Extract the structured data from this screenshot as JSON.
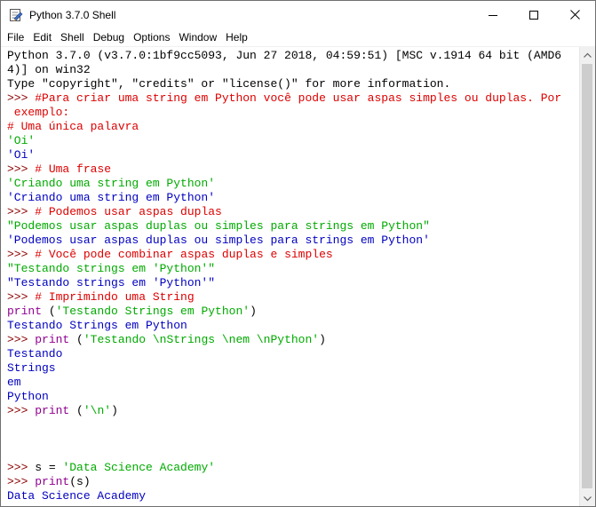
{
  "window": {
    "title": "Python 3.7.0 Shell"
  },
  "menu": [
    "File",
    "Edit",
    "Shell",
    "Debug",
    "Options",
    "Window",
    "Help"
  ],
  "shell_lines": [
    [
      {
        "t": "Python 3.7.0 (v3.7.0:1bf9cc5093, Jun 27 2018, 04:59:51) [MSC v.1914 64 bit (AMD6",
        "c": "plain"
      }
    ],
    [
      {
        "t": "4)] on win32",
        "c": "plain"
      }
    ],
    [
      {
        "t": "Type \"copyright\", \"credits\" or \"license()\" for more information.",
        "c": "plain"
      }
    ],
    [
      {
        "t": ">>> ",
        "c": "prompt"
      },
      {
        "t": "#Para criar uma string em Python você pode usar aspas simples ou duplas. Por",
        "c": "comment"
      }
    ],
    [
      {
        "t": " exemplo:",
        "c": "comment"
      }
    ],
    [
      {
        "t": "# Uma única palavra",
        "c": "comment"
      }
    ],
    [
      {
        "t": "'Oi'",
        "c": "string"
      }
    ],
    [
      {
        "t": "'Oi'",
        "c": "stdout"
      }
    ],
    [
      {
        "t": ">>> ",
        "c": "prompt"
      },
      {
        "t": "# Uma frase",
        "c": "comment"
      }
    ],
    [
      {
        "t": "'Criando uma string em Python'",
        "c": "string"
      }
    ],
    [
      {
        "t": "'Criando uma string em Python'",
        "c": "stdout"
      }
    ],
    [
      {
        "t": ">>> ",
        "c": "prompt"
      },
      {
        "t": "# Podemos usar aspas duplas",
        "c": "comment"
      }
    ],
    [
      {
        "t": "\"Podemos usar aspas duplas ou simples para strings em Python\"",
        "c": "string"
      }
    ],
    [
      {
        "t": "'Podemos usar aspas duplas ou simples para strings em Python'",
        "c": "stdout"
      }
    ],
    [
      {
        "t": ">>> ",
        "c": "prompt"
      },
      {
        "t": "# Você pode combinar aspas duplas e simples",
        "c": "comment"
      }
    ],
    [
      {
        "t": "\"Testando strings em 'Python'\"",
        "c": "string"
      }
    ],
    [
      {
        "t": "\"Testando strings em 'Python'\"",
        "c": "stdout"
      }
    ],
    [
      {
        "t": ">>> ",
        "c": "prompt"
      },
      {
        "t": "# Imprimindo uma String",
        "c": "comment"
      }
    ],
    [
      {
        "t": "print",
        "c": "builtin"
      },
      {
        "t": " (",
        "c": "plain"
      },
      {
        "t": "'Testando Strings em Python'",
        "c": "string"
      },
      {
        "t": ")",
        "c": "plain"
      }
    ],
    [
      {
        "t": "Testando Strings em Python",
        "c": "stdout"
      }
    ],
    [
      {
        "t": ">>> ",
        "c": "prompt"
      },
      {
        "t": "print",
        "c": "builtin"
      },
      {
        "t": " (",
        "c": "plain"
      },
      {
        "t": "'Testando \\nStrings \\nem \\nPython'",
        "c": "string"
      },
      {
        "t": ")",
        "c": "plain"
      }
    ],
    [
      {
        "t": "Testando",
        "c": "stdout"
      }
    ],
    [
      {
        "t": "Strings",
        "c": "stdout"
      }
    ],
    [
      {
        "t": "em",
        "c": "stdout"
      }
    ],
    [
      {
        "t": "Python",
        "c": "stdout"
      }
    ],
    [
      {
        "t": ">>> ",
        "c": "prompt"
      },
      {
        "t": "print",
        "c": "builtin"
      },
      {
        "t": " (",
        "c": "plain"
      },
      {
        "t": "'\\n'",
        "c": "string"
      },
      {
        "t": ")",
        "c": "plain"
      }
    ],
    [
      {
        "t": "",
        "c": "plain"
      }
    ],
    [
      {
        "t": "",
        "c": "plain"
      }
    ],
    [
      {
        "t": "",
        "c": "plain"
      }
    ],
    [
      {
        "t": ">>> ",
        "c": "prompt"
      },
      {
        "t": "s = ",
        "c": "plain"
      },
      {
        "t": "'Data Science Academy'",
        "c": "string"
      }
    ],
    [
      {
        "t": ">>> ",
        "c": "prompt"
      },
      {
        "t": "print",
        "c": "builtin"
      },
      {
        "t": "(s)",
        "c": "plain"
      }
    ],
    [
      {
        "t": "Data Science Academy",
        "c": "stdout"
      }
    ],
    [
      {
        "t": ">>> ",
        "c": "prompt"
      }
    ]
  ]
}
